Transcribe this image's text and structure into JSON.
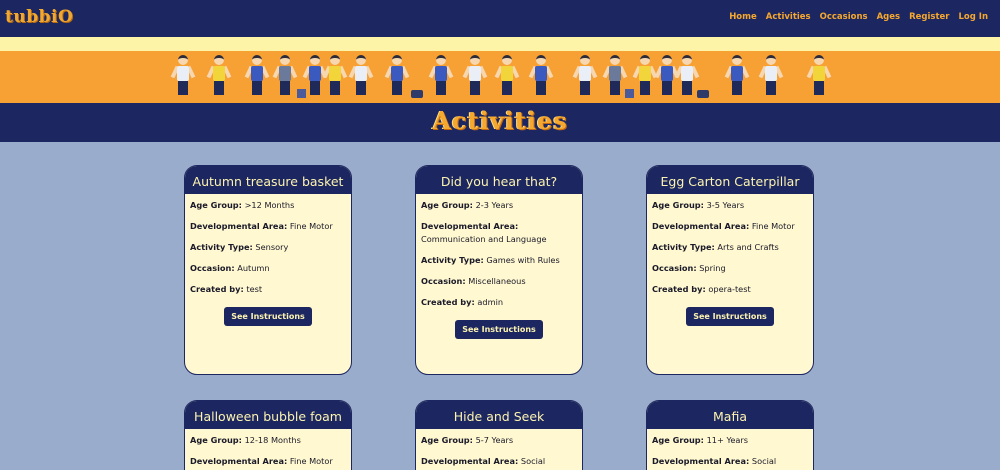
{
  "site": {
    "logo": "tubbiO",
    "nav": [
      "Home",
      "Activities",
      "Occasions",
      "Ages",
      "Register",
      "Log In"
    ],
    "page_title": "Activities"
  },
  "labels": {
    "age_group": "Age Group:",
    "developmental_area": "Developmental Area:",
    "activity_type": "Activity Type:",
    "occasion": "Occasion:",
    "created_by": "Created by:",
    "see_instructions": "See Instructions"
  },
  "cards": [
    {
      "title": "Autumn treasure basket",
      "age_group": ">12 Months",
      "developmental_area": "Fine Motor",
      "activity_type": "Sensory",
      "occasion": "Autumn",
      "created_by": "test"
    },
    {
      "title": "Did you hear that?",
      "age_group": "2-3 Years",
      "developmental_area": "Communication and Language",
      "activity_type": "Games with Rules",
      "occasion": "Miscellaneous",
      "created_by": "admin"
    },
    {
      "title": "Egg Carton Caterpillar",
      "age_group": "3-5 Years",
      "developmental_area": "Fine Motor",
      "activity_type": "Arts and Crafts",
      "occasion": "Spring",
      "created_by": "opera-test"
    },
    {
      "title": "Halloween bubble foam",
      "age_group": "12-18 Months",
      "developmental_area": "Fine Motor"
    },
    {
      "title": "Hide and Seek",
      "age_group": "5-7 Years",
      "developmental_area": "Social"
    },
    {
      "title": "Mafia",
      "age_group": "11+ Years",
      "developmental_area": "Social"
    }
  ],
  "colors": {
    "navy": "#1c2660",
    "orange": "#f7a033",
    "cream": "#fff8d0",
    "background": "#9aaccc"
  }
}
